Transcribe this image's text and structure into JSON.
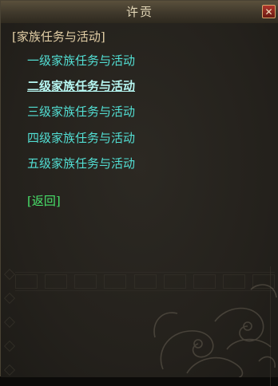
{
  "window": {
    "title": "许贡",
    "close_label": "✕"
  },
  "dialog": {
    "section_header": "[家族任务与活动]",
    "menu_items": [
      {
        "label": "一级家族任务与活动",
        "selected": false
      },
      {
        "label": "二级家族任务与活动",
        "selected": true
      },
      {
        "label": "三级家族任务与活动",
        "selected": false
      },
      {
        "label": "四级家族任务与活动",
        "selected": false
      },
      {
        "label": "五级家族任务与活动",
        "selected": false
      }
    ],
    "back_label": "[返回]"
  },
  "colors": {
    "menu_text": "#52dfd4",
    "menu_text_selected": "#b7f7f2",
    "back_text": "#48e06a",
    "header_text": "#e3cfa6",
    "close_button": "#b0362b"
  },
  "icons": {
    "close": "close-icon",
    "ornament": "cloud-dragon-ornament"
  }
}
